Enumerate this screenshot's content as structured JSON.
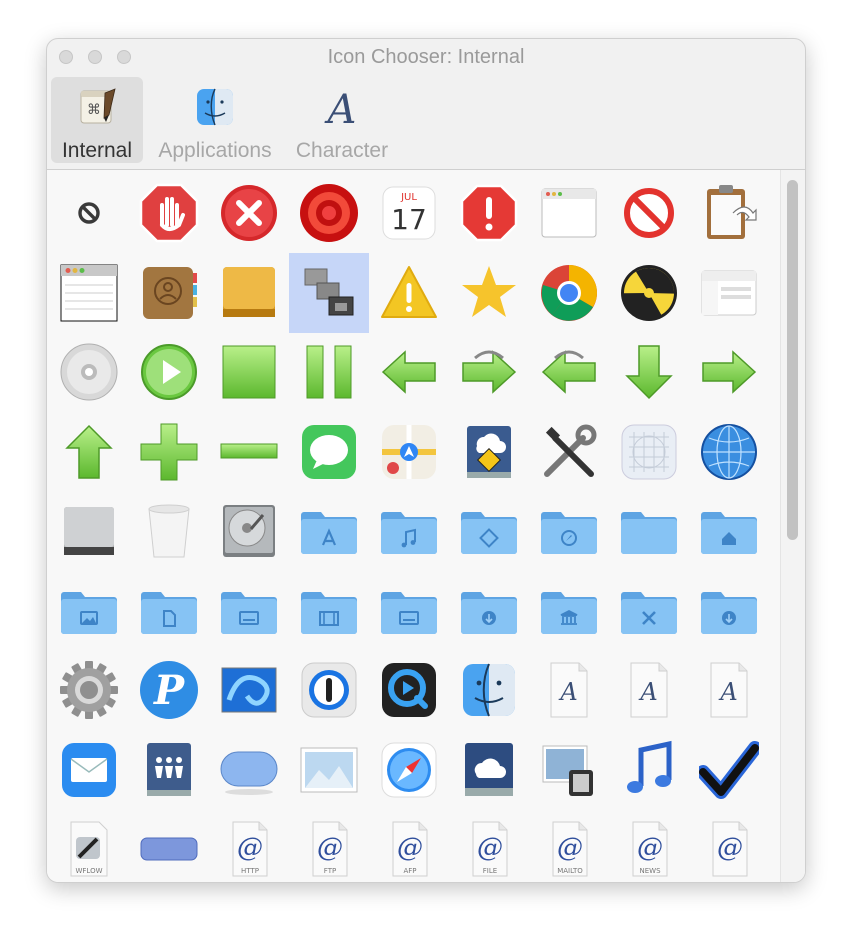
{
  "window": {
    "title": "Icon Chooser: Internal"
  },
  "toolbar": {
    "items": [
      {
        "label": "Internal",
        "icon": "script-editor-icon",
        "selected": true
      },
      {
        "label": "Applications",
        "icon": "finder-icon",
        "selected": false
      },
      {
        "label": "Character",
        "icon": "character-a-icon",
        "selected": false
      }
    ]
  },
  "colors": {
    "accent_selection": "#c6d6f8",
    "folder_blue": "#6fb5ee",
    "arrow_green": "#7fd34f"
  },
  "grid": {
    "selected_index": 12,
    "icons": [
      {
        "name": "cancel-icon",
        "kind": "cancel"
      },
      {
        "name": "stop-hand-icon",
        "kind": "stophand"
      },
      {
        "name": "close-x-icon",
        "kind": "redx"
      },
      {
        "name": "record-icon",
        "kind": "record"
      },
      {
        "name": "calendar-icon",
        "kind": "calendar",
        "month": "JUL",
        "day": "17"
      },
      {
        "name": "alert-stop-icon",
        "kind": "alertstop"
      },
      {
        "name": "window-icon",
        "kind": "window"
      },
      {
        "name": "no-entry-icon",
        "kind": "noentry"
      },
      {
        "name": "clipboard-icon",
        "kind": "clipboard"
      },
      {
        "name": "list-window-icon",
        "kind": "listwindow"
      },
      {
        "name": "contacts-icon",
        "kind": "contacts"
      },
      {
        "name": "external-drive-icon",
        "kind": "golddrive"
      },
      {
        "name": "stacked-windows-icon",
        "kind": "stacked"
      },
      {
        "name": "warning-icon",
        "kind": "warning"
      },
      {
        "name": "star-icon",
        "kind": "star"
      },
      {
        "name": "chrome-icon",
        "kind": "chrome"
      },
      {
        "name": "burn-icon",
        "kind": "burn"
      },
      {
        "name": "browser-window-icon",
        "kind": "browserwin"
      },
      {
        "name": "cd-icon",
        "kind": "cd"
      },
      {
        "name": "play-icon",
        "kind": "play"
      },
      {
        "name": "stop-square-icon",
        "kind": "square"
      },
      {
        "name": "pause-icon",
        "kind": "pause"
      },
      {
        "name": "arrow-left-icon",
        "kind": "arrow",
        "dir": "left"
      },
      {
        "name": "redo-arrow-icon",
        "kind": "arrowcurve",
        "dir": "right"
      },
      {
        "name": "undo-arrow-icon",
        "kind": "arrowcurve",
        "dir": "left"
      },
      {
        "name": "arrow-down-icon",
        "kind": "arrow",
        "dir": "down"
      },
      {
        "name": "arrow-right-icon",
        "kind": "arrow",
        "dir": "right"
      },
      {
        "name": "arrow-up-icon",
        "kind": "arrow",
        "dir": "up"
      },
      {
        "name": "plus-icon",
        "kind": "plus"
      },
      {
        "name": "minus-icon",
        "kind": "minus"
      },
      {
        "name": "messages-icon",
        "kind": "messages"
      },
      {
        "name": "maps-icon",
        "kind": "maps"
      },
      {
        "name": "public-drive-icon",
        "kind": "publicdrive"
      },
      {
        "name": "tools-icon",
        "kind": "tools"
      },
      {
        "name": "grid-icon",
        "kind": "gridicon"
      },
      {
        "name": "network-globe-icon",
        "kind": "globe"
      },
      {
        "name": "drive-icon",
        "kind": "drive"
      },
      {
        "name": "trash-icon",
        "kind": "trash"
      },
      {
        "name": "hard-disk-icon",
        "kind": "hdd"
      },
      {
        "name": "applications-folder-icon",
        "kind": "folder",
        "glyph": "apps"
      },
      {
        "name": "music-folder-icon",
        "kind": "folder",
        "glyph": "music"
      },
      {
        "name": "public-folder-icon",
        "kind": "folder",
        "glyph": "public"
      },
      {
        "name": "safari-folder-icon",
        "kind": "folder",
        "glyph": "compass"
      },
      {
        "name": "generic-folder-icon",
        "kind": "folder",
        "glyph": "none"
      },
      {
        "name": "home-folder-icon",
        "kind": "folder",
        "glyph": "home"
      },
      {
        "name": "pictures-folder-icon",
        "kind": "folder",
        "glyph": "pictures"
      },
      {
        "name": "documents-folder-icon",
        "kind": "folder",
        "glyph": "document"
      },
      {
        "name": "desktop-folder-icon",
        "kind": "folder",
        "glyph": "desktop"
      },
      {
        "name": "movies-folder-icon",
        "kind": "folder",
        "glyph": "film"
      },
      {
        "name": "desktop-folder-2-icon",
        "kind": "folder",
        "glyph": "desktop"
      },
      {
        "name": "downloads-folder-icon",
        "kind": "folder",
        "glyph": "download"
      },
      {
        "name": "library-folder-icon",
        "kind": "folder",
        "glyph": "library"
      },
      {
        "name": "utilities-folder-icon",
        "kind": "folder",
        "glyph": "tools"
      },
      {
        "name": "downloads-folder-2-icon",
        "kind": "folder",
        "glyph": "download"
      },
      {
        "name": "gear-icon",
        "kind": "gear"
      },
      {
        "name": "pages-p-icon",
        "kind": "pbadge"
      },
      {
        "name": "wallpaper-icon",
        "kind": "wallpaper"
      },
      {
        "name": "1password-icon",
        "kind": "onepassword"
      },
      {
        "name": "quicktime-icon",
        "kind": "quicktime"
      },
      {
        "name": "finder-icon",
        "kind": "finder"
      },
      {
        "name": "font-document-icon",
        "kind": "fontdoc"
      },
      {
        "name": "font-document-2-icon",
        "kind": "fontdoc"
      },
      {
        "name": "font-document-3-icon",
        "kind": "fontdoc"
      },
      {
        "name": "mail-icon",
        "kind": "mail"
      },
      {
        "name": "shared-users-drive-icon",
        "kind": "usersdrive"
      },
      {
        "name": "pill-button-icon",
        "kind": "pill"
      },
      {
        "name": "picture-frame-icon",
        "kind": "picture"
      },
      {
        "name": "safari-icon",
        "kind": "safari"
      },
      {
        "name": "icloud-drive-icon",
        "kind": "iclouddrive"
      },
      {
        "name": "preview-icon",
        "kind": "preview"
      },
      {
        "name": "music-note-icon",
        "kind": "musicnote"
      },
      {
        "name": "checkmark-icon",
        "kind": "checkmark"
      },
      {
        "name": "workflow-document-icon",
        "kind": "wflow",
        "label": "WFLOW"
      },
      {
        "name": "bar-button-icon",
        "kind": "bar"
      },
      {
        "name": "http-location-icon",
        "kind": "atdoc",
        "label": "HTTP"
      },
      {
        "name": "ftp-location-icon",
        "kind": "atdoc",
        "label": "FTP"
      },
      {
        "name": "afp-location-icon",
        "kind": "atdoc",
        "label": "AFP"
      },
      {
        "name": "file-location-icon",
        "kind": "atdoc",
        "label": "FILE"
      },
      {
        "name": "mailto-location-icon",
        "kind": "atdoc",
        "label": "MAILTO"
      },
      {
        "name": "news-location-icon",
        "kind": "atdoc",
        "label": "NEWS"
      },
      {
        "name": "location-icon",
        "kind": "atdoc",
        "label": ""
      }
    ]
  }
}
